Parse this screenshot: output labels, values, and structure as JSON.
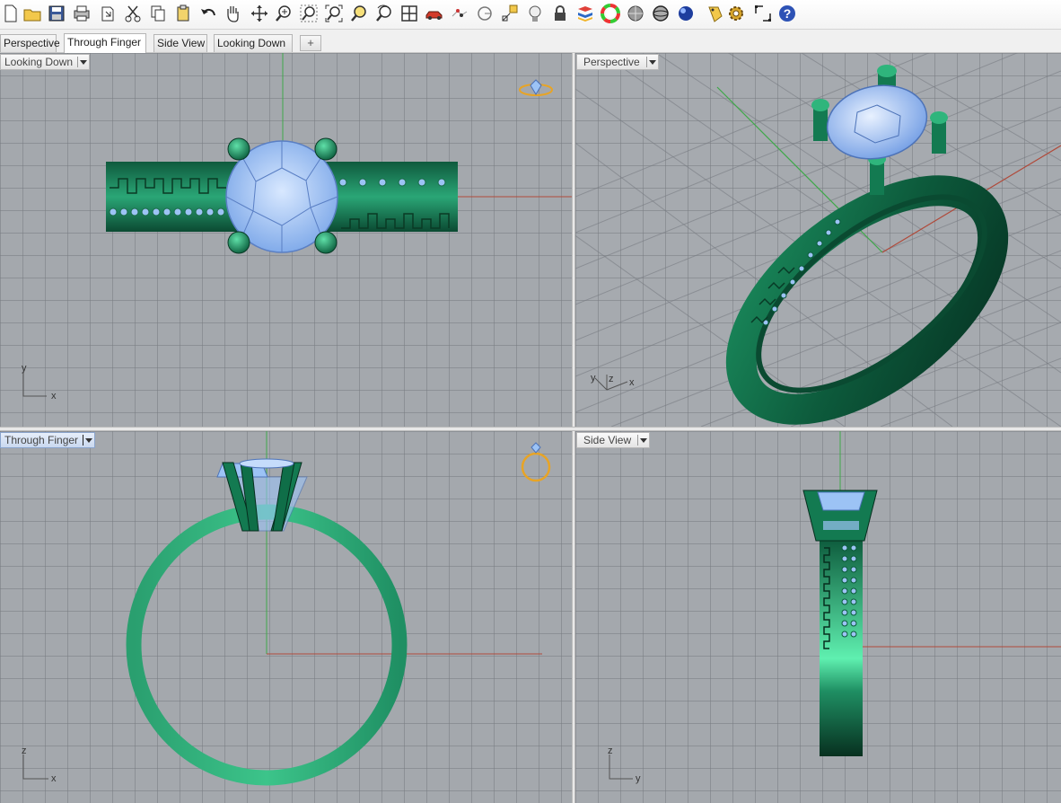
{
  "toolbar": {
    "buttons": [
      "new-file",
      "open-file",
      "save",
      "print",
      "import",
      "cut",
      "copy",
      "paste",
      "undo",
      "pan",
      "move",
      "zoom-in",
      "zoom-window",
      "zoom-extents",
      "zoom-selected",
      "rotate-view",
      "four-viewports",
      "car",
      "points",
      "circle",
      "dim",
      "bulb",
      "lock",
      "layers",
      "color-wheel",
      "shaded",
      "rendered",
      "sphere",
      "tag",
      "gear",
      "select-tool",
      "help"
    ]
  },
  "tabs": [
    "Perspective",
    "Through Finger",
    "Side View",
    "Looking Down"
  ],
  "active_tab": "Through Finger",
  "add_tab_icon": "plus-icon",
  "viewports": {
    "top_left": {
      "label": "Looking Down",
      "axis_a": "y",
      "axis_b": "x"
    },
    "top_right": {
      "label": "Perspective",
      "axis_a": "y",
      "axis_b": "z",
      "axis_c": "x"
    },
    "bottom_left": {
      "label": "Through Finger",
      "axis_a": "z",
      "axis_b": "x"
    },
    "bottom_right": {
      "label": "Side View",
      "axis_a": "z",
      "axis_b": "y"
    }
  },
  "colors": {
    "ring_green": "#1f8f63",
    "gem_blue": "#9cc3f5",
    "axis_red": "#b04a3a",
    "axis_green": "#3fa84a",
    "gizmo_orange": "#e8a425"
  }
}
